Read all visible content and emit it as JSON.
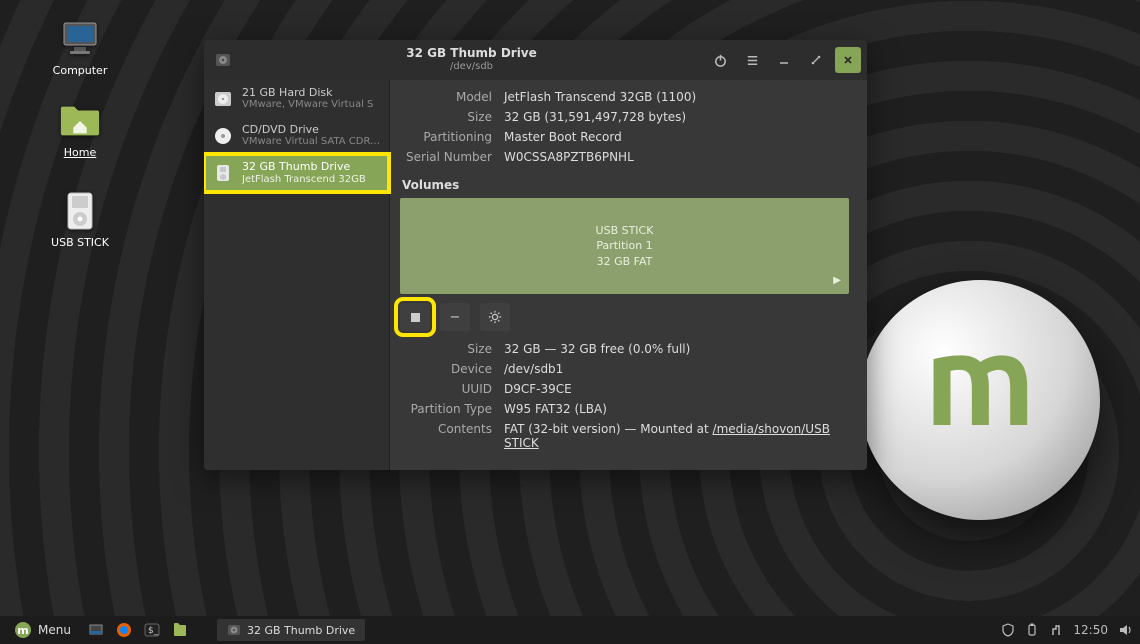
{
  "desktop": {
    "icons": [
      {
        "label": "Computer"
      },
      {
        "label": "Home"
      },
      {
        "label": "USB STICK"
      }
    ]
  },
  "window": {
    "title": "32 GB Thumb Drive",
    "subtitle": "/dev/sdb",
    "devices": [
      {
        "title": "21 GB Hard Disk",
        "sub": "VMware, VMware Virtual S"
      },
      {
        "title": "CD/DVD Drive",
        "sub": "VMware Virtual SATA CDRW Drive"
      },
      {
        "title": "32 GB Thumb Drive",
        "sub": "JetFlash Transcend 32GB"
      }
    ],
    "info": {
      "model_k": "Model",
      "model_v": "JetFlash Transcend 32GB (1100)",
      "size_k": "Size",
      "size_v": "32 GB (31,591,497,728 bytes)",
      "part_k": "Partitioning",
      "part_v": "Master Boot Record",
      "serial_k": "Serial Number",
      "serial_v": "W0CSSA8PZTB6PNHL"
    },
    "volumes_heading": "Volumes",
    "volume": {
      "name": "USB STICK",
      "line2": "Partition 1",
      "line3": "32 GB FAT"
    },
    "vol_info": {
      "size_k": "Size",
      "size_v": "32 GB — 32 GB free (0.0% full)",
      "device_k": "Device",
      "device_v": "/dev/sdb1",
      "uuid_k": "UUID",
      "uuid_v": "D9CF-39CE",
      "ptype_k": "Partition Type",
      "ptype_v": "W95 FAT32 (LBA)",
      "contents_k": "Contents",
      "contents_prefix": "FAT (32-bit version) — Mounted at ",
      "contents_link": "/media/shovon/USB STICK"
    }
  },
  "taskbar": {
    "menu": "Menu",
    "active_task": "32 GB Thumb Drive",
    "clock": "12:50"
  }
}
